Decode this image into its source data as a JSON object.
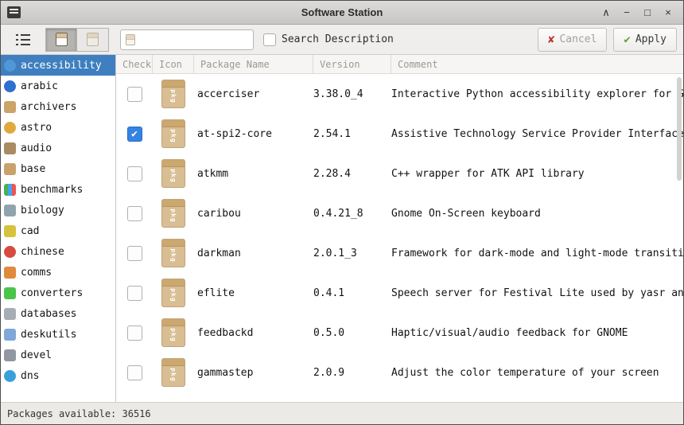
{
  "window": {
    "title": "Software Station",
    "controls": {
      "shade": "∧",
      "minimize": "−",
      "maximize": "□",
      "close": "×"
    }
  },
  "toolbar": {
    "search_value": "",
    "search_description_label": "Search Description",
    "cancel_label": "Cancel",
    "apply_label": "Apply"
  },
  "sidebar": {
    "items": [
      {
        "label": "accessibility",
        "selected": true
      },
      {
        "label": "arabic",
        "selected": false
      },
      {
        "label": "archivers",
        "selected": false
      },
      {
        "label": "astro",
        "selected": false
      },
      {
        "label": "audio",
        "selected": false
      },
      {
        "label": "base",
        "selected": false
      },
      {
        "label": "benchmarks",
        "selected": false
      },
      {
        "label": "biology",
        "selected": false
      },
      {
        "label": "cad",
        "selected": false
      },
      {
        "label": "chinese",
        "selected": false
      },
      {
        "label": "comms",
        "selected": false
      },
      {
        "label": "converters",
        "selected": false
      },
      {
        "label": "databases",
        "selected": false
      },
      {
        "label": "deskutils",
        "selected": false
      },
      {
        "label": "devel",
        "selected": false
      },
      {
        "label": "dns",
        "selected": false
      }
    ]
  },
  "table": {
    "columns": [
      "Check",
      "Icon",
      "Package Name",
      "Version",
      "Comment"
    ],
    "rows": [
      {
        "checked": false,
        "name": "accerciser",
        "version": "3.38.0_4",
        "comment": "Interactive Python accessibility explorer for GNOME"
      },
      {
        "checked": true,
        "name": "at-spi2-core",
        "version": "2.54.1",
        "comment": "Assistive Technology Service Provider Interface"
      },
      {
        "checked": false,
        "name": "atkmm",
        "version": "2.28.4",
        "comment": "C++ wrapper for ATK API library"
      },
      {
        "checked": false,
        "name": "caribou",
        "version": "0.4.21_8",
        "comment": "Gnome On-Screen keyboard"
      },
      {
        "checked": false,
        "name": "darkman",
        "version": "2.0.1_3",
        "comment": "Framework for dark-mode and light-mode transitions in"
      },
      {
        "checked": false,
        "name": "eflite",
        "version": "0.4.1",
        "comment": "Speech server for Festival Lite used by yasr and Emacspeak"
      },
      {
        "checked": false,
        "name": "feedbackd",
        "version": "0.5.0",
        "comment": "Haptic/visual/audio feedback for GNOME"
      },
      {
        "checked": false,
        "name": "gammastep",
        "version": "2.0.9",
        "comment": "Adjust the color temperature of your screen"
      }
    ]
  },
  "icons": {
    "pkg_label": "pkg"
  },
  "statusbar": {
    "text": "Packages available: 36516"
  },
  "colors": {
    "selection": "#3f7fbf",
    "checkbox_checked": "#3584e4",
    "cancel_x": "#c23434",
    "apply_check": "#5aa339"
  }
}
